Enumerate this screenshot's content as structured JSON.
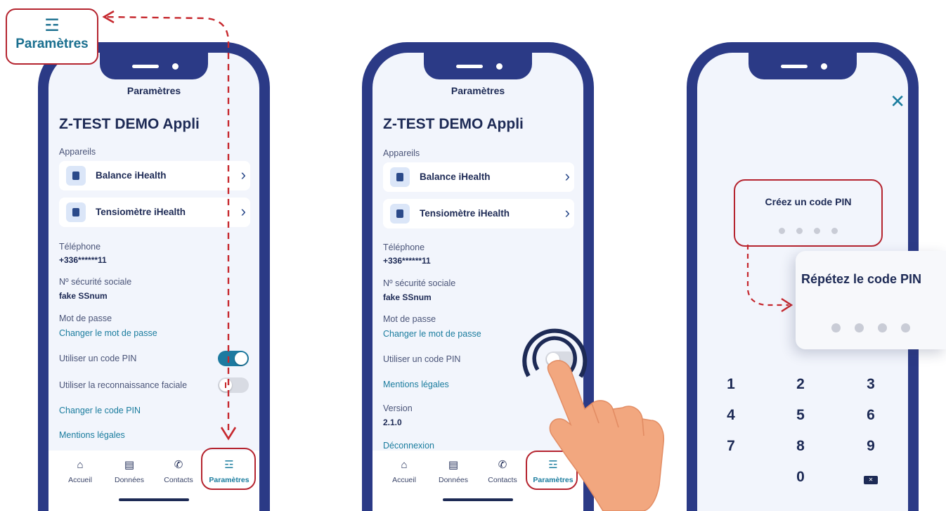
{
  "colors": {
    "frame": "#2b3a86",
    "accent": "#1a7c9e",
    "highlight": "#b5242f",
    "text": "#1d2a55"
  },
  "badge": {
    "icon": "sliders-icon",
    "label": "Paramètres"
  },
  "phone1": {
    "title": "Paramètres",
    "app_name": "Z-TEST DEMO Appli",
    "devices_label": "Appareils",
    "devices": [
      {
        "icon": "scale-icon",
        "label": "Balance iHealth"
      },
      {
        "icon": "blood-pressure-icon",
        "label": "Tensiomètre iHealth"
      }
    ],
    "phone_label": "Téléphone",
    "phone_value": "+336******11",
    "ss_label": "Nº sécurité sociale",
    "ss_value": "fake SSnum",
    "password_label": "Mot de passe",
    "password_link": "Changer le mot de passe",
    "pin_toggle_label": "Utiliser un code PIN",
    "pin_toggle_state": "on",
    "face_toggle_label": "Utiliser la reconnaissance faciale",
    "face_toggle_state": "off",
    "change_pin_link": "Changer le code PIN",
    "legal_link": "Mentions légales"
  },
  "phone2": {
    "title": "Paramètres",
    "app_name": "Z-TEST DEMO Appli",
    "devices_label": "Appareils",
    "devices": [
      {
        "icon": "scale-icon",
        "label": "Balance iHealth"
      },
      {
        "icon": "blood-pressure-icon",
        "label": "Tensiomètre iHealth"
      }
    ],
    "phone_label": "Téléphone",
    "phone_value": "+336******11",
    "ss_label": "Nº sécurité sociale",
    "ss_value": "fake SSnum",
    "password_label": "Mot de passe",
    "password_link": "Changer le mot de passe",
    "pin_toggle_label": "Utiliser un code PIN",
    "pin_toggle_state": "off",
    "legal_link": "Mentions légales",
    "version_label": "Version",
    "version_value": "2.1.0",
    "logout_link": "Déconnexion"
  },
  "nav": {
    "items": [
      {
        "icon": "home-icon",
        "label": "Accueil"
      },
      {
        "icon": "chart-icon",
        "label": "Données"
      },
      {
        "icon": "phone-icon",
        "label": "Contacts"
      },
      {
        "icon": "sliders-icon",
        "label": "Paramètres"
      }
    ],
    "active_index": 3
  },
  "phone3": {
    "close_icon": "close-icon",
    "create_pin_title": "Créez un code PIN",
    "repeat_pin_title": "Répétez le code PIN",
    "keys": [
      "1",
      "2",
      "3",
      "4",
      "5",
      "6",
      "7",
      "8",
      "9",
      "0"
    ],
    "delete_key_icon": "backspace-icon"
  }
}
